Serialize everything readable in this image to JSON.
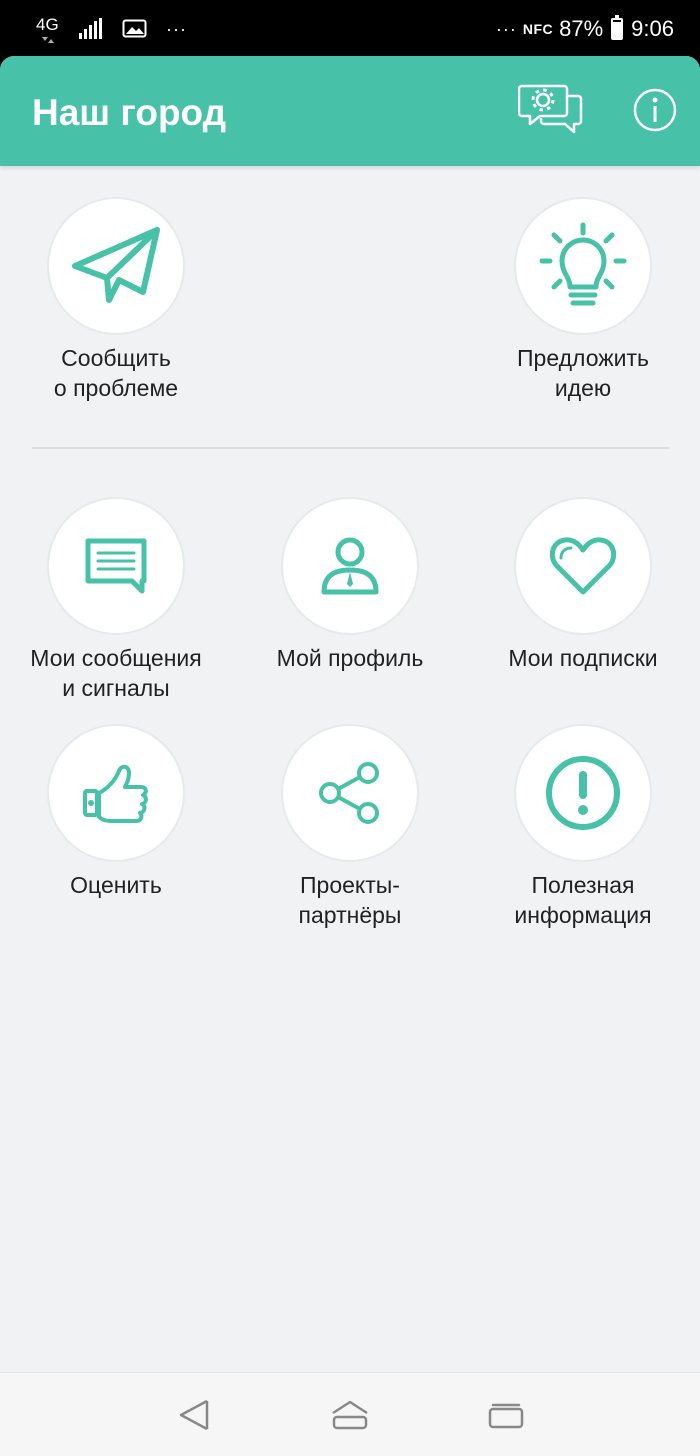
{
  "status_bar": {
    "network": "4G",
    "overflow_dots": "···",
    "nfc": "NFC",
    "battery_percent": "87%",
    "battery_level": 0.87,
    "time": "9:06",
    "icons": [
      "4g-icon",
      "signal-icon",
      "image-icon",
      "nfc-icon",
      "battery-icon"
    ]
  },
  "app_bar": {
    "title": "Наш город",
    "actions": [
      {
        "icon": "chat-settings-icon"
      },
      {
        "icon": "info-icon"
      }
    ]
  },
  "primary_actions": [
    {
      "label": "Сообщить\nо проблеме",
      "icon": "paper-plane-icon"
    },
    {
      "label": "Предложить\nидею",
      "icon": "lightbulb-icon"
    }
  ],
  "menu": [
    {
      "label": "Мои сообщения\nи сигналы",
      "icon": "message-icon"
    },
    {
      "label": "Мой профиль",
      "icon": "user-icon"
    },
    {
      "label": "Мои подписки",
      "icon": "heart-icon"
    },
    {
      "label": "Оценить",
      "icon": "thumbs-up-icon"
    },
    {
      "label": "Проекты-\nпартнёры",
      "icon": "share-icon"
    },
    {
      "label": "Полезная\nинформация",
      "icon": "exclamation-icon"
    }
  ],
  "nav_bar": {
    "buttons": [
      "back-icon",
      "home-icon",
      "recents-icon"
    ]
  },
  "colors": {
    "accent": "#47c2a8",
    "background": "#f0f2f4",
    "text": "#222222"
  }
}
